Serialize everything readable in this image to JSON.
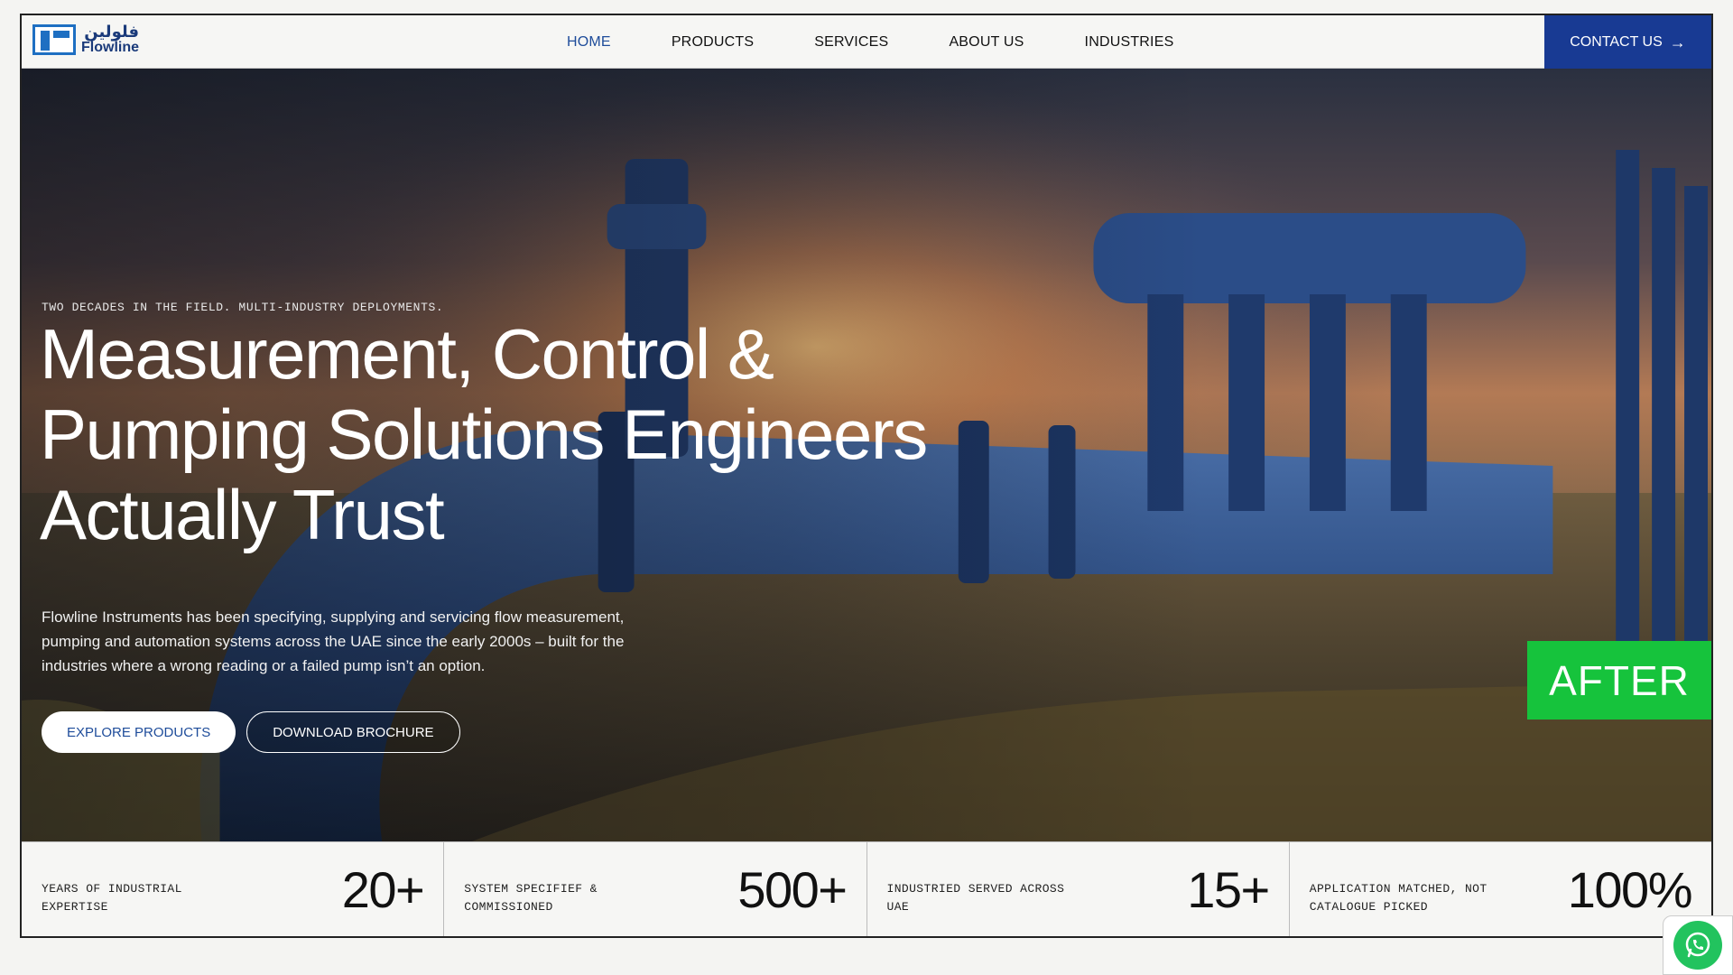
{
  "brand": {
    "name_ar": "فلولين",
    "name_en": "Flowline"
  },
  "nav": {
    "items": [
      {
        "label": "HOME",
        "active": true
      },
      {
        "label": "PRODUCTS",
        "active": false
      },
      {
        "label": "SERVICES",
        "active": false
      },
      {
        "label": "ABOUT US",
        "active": false
      },
      {
        "label": "INDUSTRIES",
        "active": false
      }
    ],
    "contact_label": "CONTACT US",
    "contact_icon": "arrow-right-icon"
  },
  "hero": {
    "eyebrow": "TWO DECADES IN THE FIELD. MULTI-INDUSTRY DEPLOYMENTS.",
    "headline": "Measurement, Control & Pumping Solutions Engineers Actually Trust",
    "lead": "Flowline Instruments has been specifying, supplying and servicing flow measurement, pumping and automation systems across the UAE since the early 2000s – built for the industries where a wrong reading or a failed pump isn’t an option.",
    "primary_cta": "EXPLORE PRODUCTS",
    "secondary_cta": "DOWNLOAD BROCHURE",
    "badge": "AFTER"
  },
  "stats": [
    {
      "label": "YEARS OF INDUSTRIAL EXPERTISE",
      "value": "20+"
    },
    {
      "label": "SYSTEM SPECIFIEF & COMMISSIONED",
      "value": "500+"
    },
    {
      "label": "INDUSTRIED SERVED ACROSS UAE",
      "value": "15+"
    },
    {
      "label": "APPLICATION MATCHED, NOT CATALOGUE PICKED",
      "value": "100%"
    }
  ],
  "colors": {
    "primary": "#183a93",
    "active_link": "#1e4c9a",
    "badge": "#16c33c",
    "whatsapp": "#22c35e"
  },
  "widgets": {
    "chat_icon": "whatsapp-icon"
  }
}
